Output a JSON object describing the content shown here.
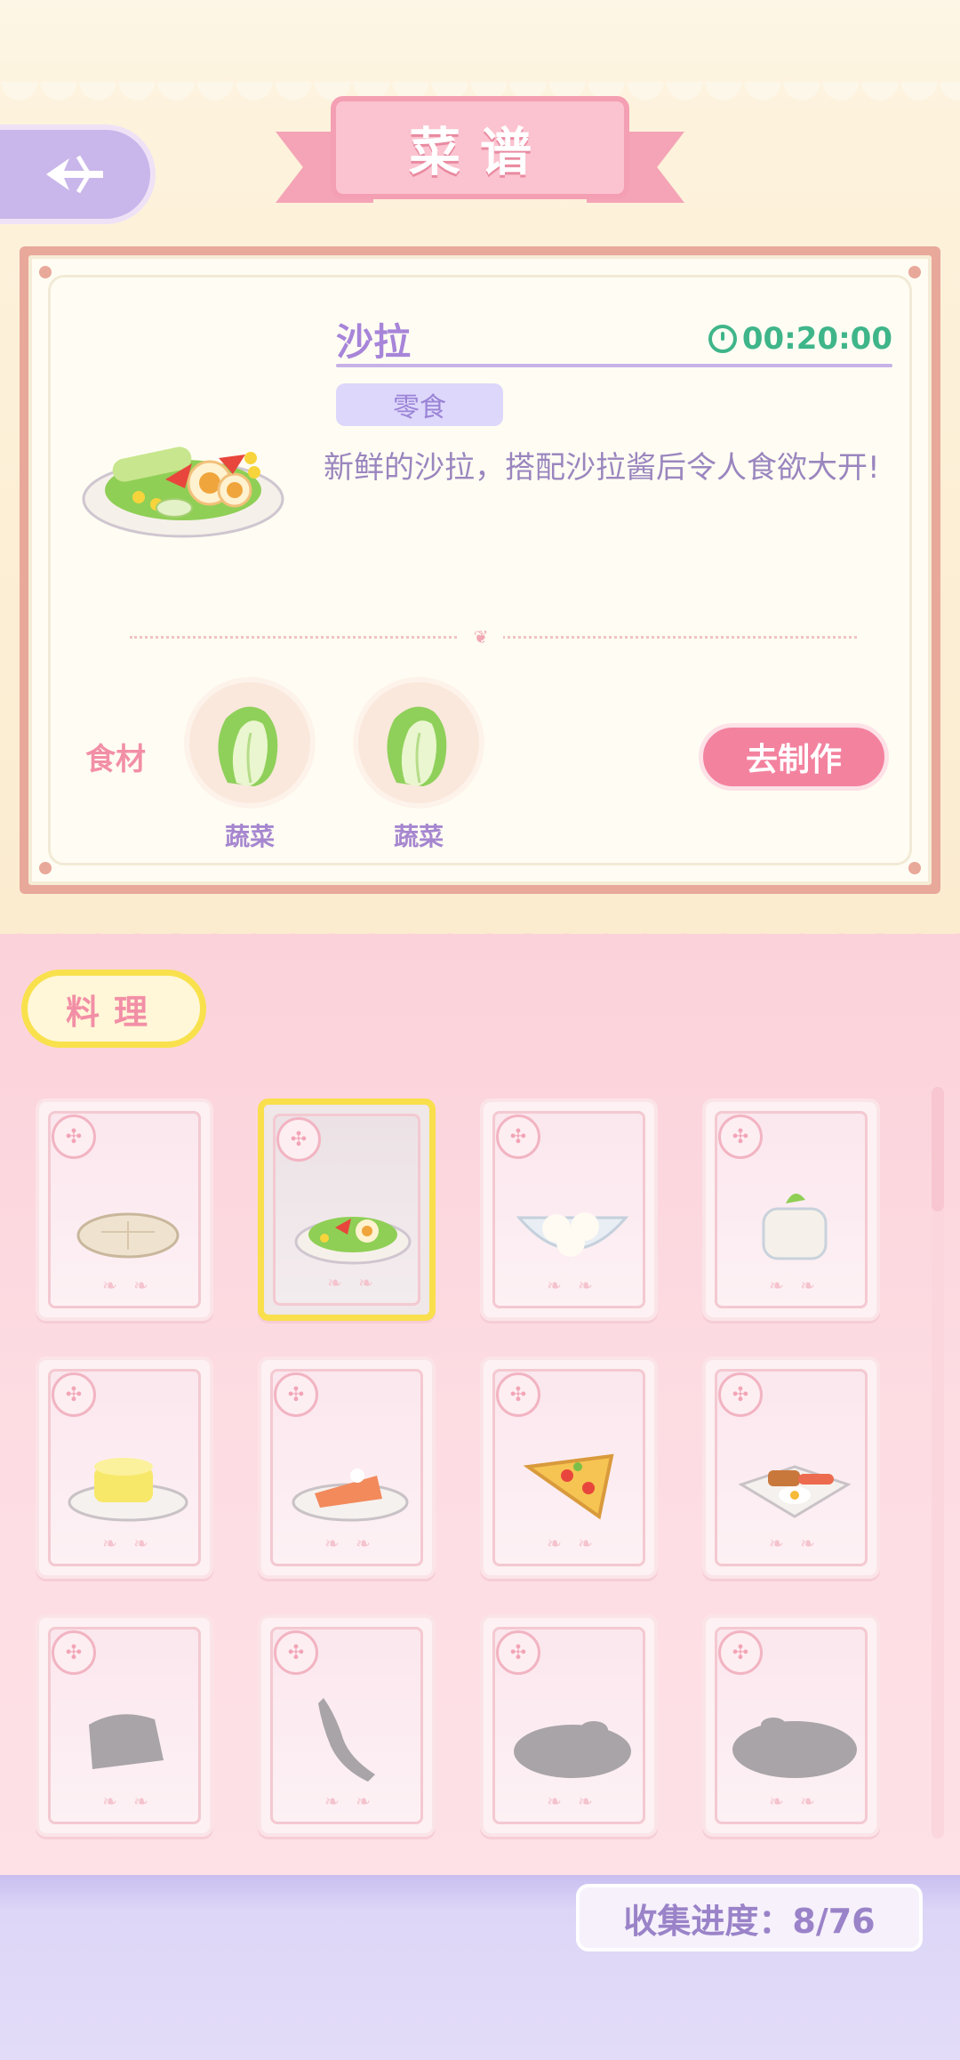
{
  "header": {
    "title": "菜谱"
  },
  "recipe": {
    "name": "沙拉",
    "timer": "00:20:00",
    "tag": "零食",
    "description": "新鲜的沙拉，搭配沙拉酱后令人食欲大开!",
    "ingredients_label": "食材",
    "ingredients": [
      {
        "name": "蔬菜",
        "icon": "cabbage-icon"
      },
      {
        "name": "蔬菜",
        "icon": "cabbage-icon"
      }
    ],
    "make_button": "去制作"
  },
  "category": {
    "label": "料理"
  },
  "dishes": [
    {
      "icon": "flatbread-icon",
      "unlocked": true,
      "selected": false
    },
    {
      "icon": "salad-icon",
      "unlocked": true,
      "selected": true
    },
    {
      "icon": "rice-balls-icon",
      "unlocked": true,
      "selected": false
    },
    {
      "icon": "pudding-icon",
      "unlocked": true,
      "selected": false
    },
    {
      "icon": "cheese-icon",
      "unlocked": true,
      "selected": false
    },
    {
      "icon": "salmon-cake-icon",
      "unlocked": true,
      "selected": false
    },
    {
      "icon": "pizza-icon",
      "unlocked": true,
      "selected": false
    },
    {
      "icon": "breakfast-plate-icon",
      "unlocked": true,
      "selected": false
    },
    {
      "icon": "locked-silhouette-icon",
      "unlocked": false,
      "selected": false
    },
    {
      "icon": "locked-silhouette-icon",
      "unlocked": false,
      "selected": false
    },
    {
      "icon": "locked-silhouette-icon",
      "unlocked": false,
      "selected": false
    },
    {
      "icon": "locked-silhouette-icon",
      "unlocked": false,
      "selected": false
    }
  ],
  "progress": {
    "text": "收集进度：8/76"
  },
  "colors": {
    "accent_pink": "#f3829f",
    "accent_purple": "#a785d9",
    "timer_green": "#3fb58a",
    "selected_yellow": "#f9df4c"
  }
}
